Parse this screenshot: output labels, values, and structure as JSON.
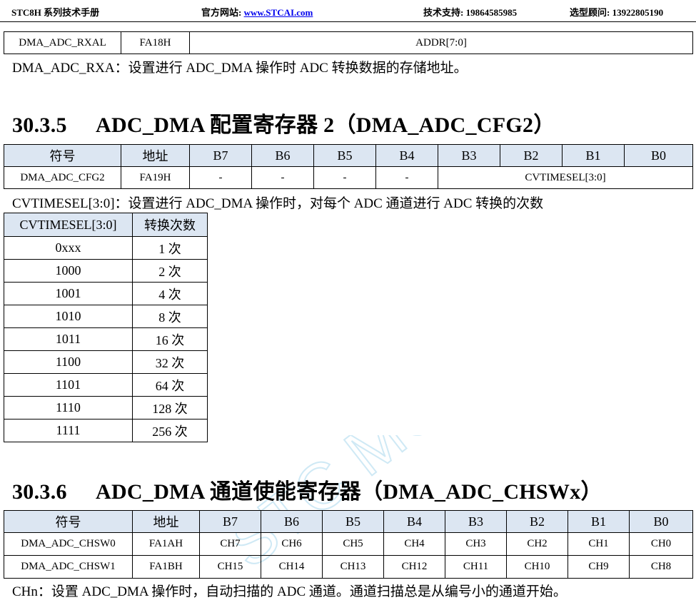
{
  "header": {
    "doc_title": "STC8H 系列技术手册",
    "website_label": "官方网站: ",
    "website_url": "www.STCAI.com",
    "support_label": "技术支持: 19864585985",
    "selection_label": "选型顾问: 13922805190"
  },
  "rxal_table": {
    "name": "DMA_ADC_RXAL",
    "address": "FA18H",
    "field": "ADDR[7:0]"
  },
  "rxa_description": "DMA_ADC_RXA：设置进行 ADC_DMA 操作时 ADC 转换数据的存储地址。",
  "section_305": {
    "number": "30.3.5",
    "title": "ADC_DMA 配置寄存器 2（DMA_ADC_CFG2）"
  },
  "cfg2_table": {
    "headers": [
      "符号",
      "地址",
      "B7",
      "B6",
      "B5",
      "B4",
      "B3",
      "B2",
      "B1",
      "B0"
    ],
    "row": {
      "name": "DMA_ADC_CFG2",
      "address": "FA19H",
      "bits": [
        "-",
        "-",
        "-",
        "-"
      ],
      "field": "CVTIMESEL[3:0]"
    }
  },
  "cvtimesel_description": "CVTIMESEL[3:0]：设置进行 ADC_DMA 操作时，对每个 ADC 通道进行 ADC 转换的次数",
  "cvtimesel_table": {
    "headers": [
      "CVTIMESEL[3:0]",
      "转换次数"
    ],
    "rows": [
      [
        "0xxx",
        "1 次"
      ],
      [
        "1000",
        "2 次"
      ],
      [
        "1001",
        "4 次"
      ],
      [
        "1010",
        "8 次"
      ],
      [
        "1011",
        "16 次"
      ],
      [
        "1100",
        "32 次"
      ],
      [
        "1101",
        "64 次"
      ],
      [
        "1110",
        "128 次"
      ],
      [
        "1111",
        "256 次"
      ]
    ]
  },
  "section_306": {
    "number": "30.3.6",
    "title": "ADC_DMA 通道使能寄存器（DMA_ADC_CHSWx）"
  },
  "chsw_table": {
    "headers": [
      "符号",
      "地址",
      "B7",
      "B6",
      "B5",
      "B4",
      "B3",
      "B2",
      "B1",
      "B0"
    ],
    "rows": [
      [
        "DMA_ADC_CHSW0",
        "FA1AH",
        "CH7",
        "CH6",
        "CH5",
        "CH4",
        "CH3",
        "CH2",
        "CH1",
        "CH0"
      ],
      [
        "DMA_ADC_CHSW1",
        "FA1BH",
        "CH15",
        "CH14",
        "CH13",
        "CH12",
        "CH11",
        "CH10",
        "CH9",
        "CH8"
      ]
    ]
  },
  "chn_description": "CHn：设置 ADC_DMA 操作时，自动扫描的 ADC 通道。通道扫描总是从编号小的通道开始。",
  "watermark_text": "STC MCU",
  "colors": {
    "table_header_bg": "#dce6f2",
    "link": "#0000ee",
    "watermark": "#cfe9f5"
  }
}
